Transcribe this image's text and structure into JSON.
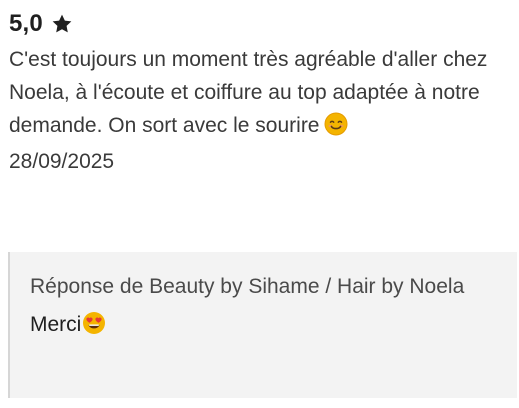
{
  "review": {
    "rating": "5,0",
    "star_icon": "star-icon",
    "text": "C'est toujours un moment très agréable d'aller chez Noela, à l'écoute et coiffure au top adaptée à notre demande. On sort avec le sourire",
    "emoji": "smiling-face-emoji",
    "date": "28/09/2025"
  },
  "response": {
    "title": "Réponse de Beauty by Sihame / Hair by Noela",
    "text": "Merci",
    "emoji": "heart-eyes-emoji"
  },
  "colors": {
    "background": "#ffffff",
    "response_background": "#f3f3f3",
    "response_border": "#d6d6d6",
    "text": "#3a3a3a"
  }
}
